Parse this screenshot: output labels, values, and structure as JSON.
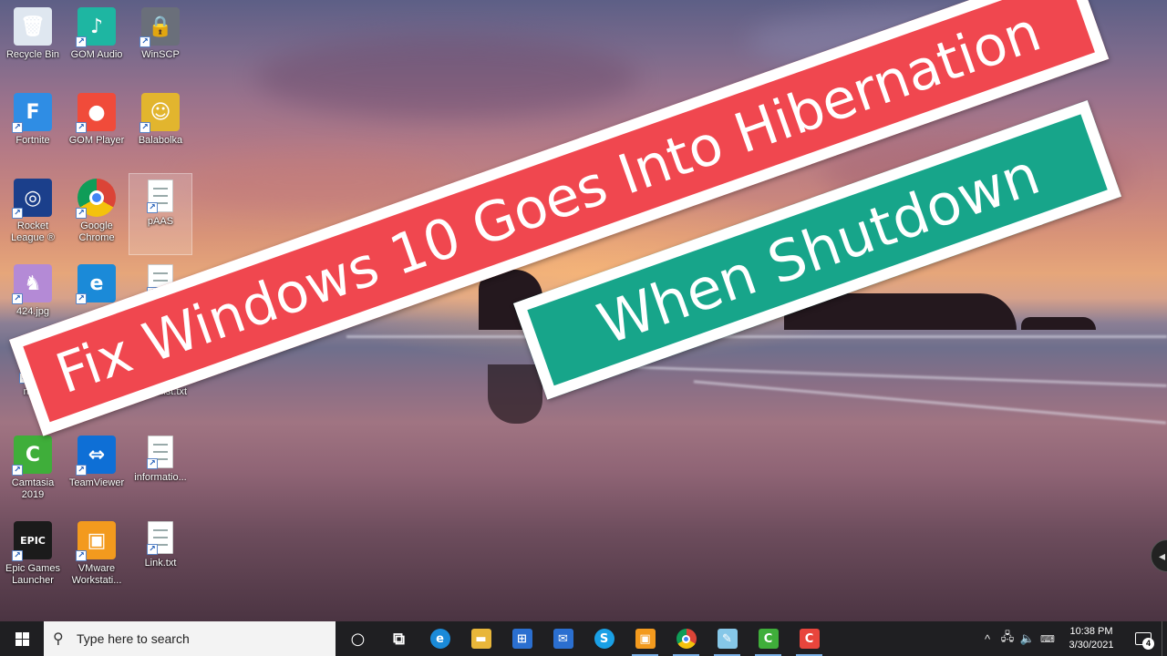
{
  "desktop": {
    "icons": [
      {
        "label": "Recycle Bin",
        "icon": "recycle-bin-icon",
        "color": "#dfe7f0",
        "glyph": "🗑"
      },
      {
        "label": "GOM Audio",
        "icon": "gom-audio-icon",
        "color": "#1eb6a2",
        "glyph": "♪"
      },
      {
        "label": "WinSCP",
        "icon": "winscp-icon",
        "color": "#6a6f7a",
        "glyph": "🔒"
      },
      {
        "label": "Fortnite",
        "icon": "fortnite-icon",
        "color": "#2f8de4",
        "glyph": "F"
      },
      {
        "label": "GOM Player",
        "icon": "gom-player-icon",
        "color": "#f04b3a",
        "glyph": "●"
      },
      {
        "label": "Balabolka",
        "icon": "balabolka-icon",
        "color": "#e2b52e",
        "glyph": "☺"
      },
      {
        "label": "Rocket League ®",
        "icon": "rocket-league-icon",
        "color": "#1b3f8b",
        "glyph": "◎"
      },
      {
        "label": "Google Chrome",
        "icon": "google-chrome-icon",
        "color": "#ffffff",
        "glyph": ""
      },
      {
        "label": "pAAS",
        "icon": "text-file-icon",
        "color": "#ffffff",
        "glyph": ""
      },
      {
        "label": "424.jpg",
        "icon": "image-file-icon",
        "color": "#b48ad6",
        "glyph": "♞"
      },
      {
        "label": "",
        "icon": "edge-icon",
        "color": "#1b8ad8",
        "glyph": "e"
      },
      {
        "label": "",
        "icon": "text-file-icon",
        "color": "#ffffff",
        "glyph": ""
      },
      {
        "label": "micr",
        "icon": "file-icon",
        "color": "#ffffff",
        "glyph": ""
      },
      {
        "label": "githublist.txt",
        "icon": "text-file-icon",
        "color": "#ffffff",
        "glyph": ""
      },
      {
        "label": "Camtasia 2019",
        "icon": "camtasia-icon",
        "color": "#3fae3a",
        "glyph": "C"
      },
      {
        "label": "TeamViewer",
        "icon": "teamviewer-icon",
        "color": "#0e6fd6",
        "glyph": "⇔"
      },
      {
        "label": "informatio...",
        "icon": "text-file-icon",
        "color": "#ffffff",
        "glyph": ""
      },
      {
        "label": "Epic Games Launcher",
        "icon": "epic-games-icon",
        "color": "#1b1b1b",
        "glyph": "EPIC"
      },
      {
        "label": "VMware Workstati...",
        "icon": "vmware-icon",
        "color": "#f39a1e",
        "glyph": "▣"
      },
      {
        "label": "Link.txt",
        "icon": "text-file-icon",
        "color": "#ffffff",
        "glyph": ""
      }
    ]
  },
  "banners": {
    "line1": "Fix Windows 10 Goes Into Hibernation",
    "line2": "When Shutdown",
    "line1_color": "#f0474f",
    "line2_color": "#17a58a"
  },
  "taskbar": {
    "search_placeholder": "Type here to search",
    "apps": [
      {
        "name": "cortana",
        "icon": "cortana-icon",
        "glyph": "○"
      },
      {
        "name": "task-view",
        "icon": "task-view-icon",
        "glyph": "⧉"
      },
      {
        "name": "edge",
        "icon": "edge-icon",
        "glyph": "e",
        "color": "#1b8ad8"
      },
      {
        "name": "file-explorer",
        "icon": "folder-icon",
        "glyph": "▬",
        "color": "#e8b63a"
      },
      {
        "name": "store",
        "icon": "store-icon",
        "glyph": "⊞",
        "color": "#2b6fd0"
      },
      {
        "name": "mail",
        "icon": "mail-icon",
        "glyph": "✉",
        "color": "#2b6fd0"
      },
      {
        "name": "skype",
        "icon": "skype-icon",
        "glyph": "S",
        "color": "#1aa0e6"
      },
      {
        "name": "vmware",
        "icon": "vmware-icon",
        "glyph": "▣",
        "color": "#f39a1e"
      },
      {
        "name": "chrome",
        "icon": "chrome-icon",
        "glyph": "",
        "color": "#ffffff"
      },
      {
        "name": "notepad",
        "icon": "notepad-icon",
        "glyph": "✎",
        "color": "#86c7e8"
      },
      {
        "name": "camtasia",
        "icon": "camtasia-icon",
        "glyph": "C",
        "color": "#3fae3a"
      },
      {
        "name": "camtasia-recorder",
        "icon": "camtasia-recorder-icon",
        "glyph": "C",
        "color": "#e8453c"
      }
    ],
    "clock_time": "10:38 PM",
    "clock_date": "3/30/2021",
    "notification_count": "4"
  }
}
